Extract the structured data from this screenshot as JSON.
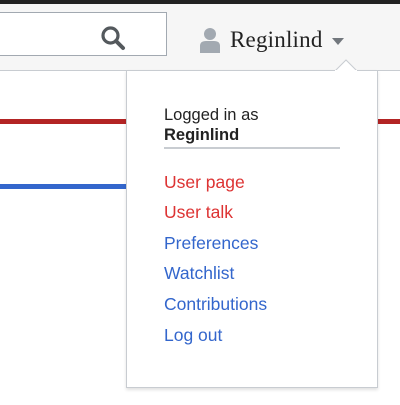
{
  "header": {
    "search": {
      "value": "",
      "icon": "search-icon"
    },
    "user": {
      "name": "Reginlind",
      "icon": "user-icon",
      "caret_icon": "chevron-down-icon"
    }
  },
  "dropdown": {
    "logged_in_label": "Logged in as",
    "username": "Reginlind",
    "items": [
      {
        "label": "User page",
        "color": "#dd3333"
      },
      {
        "label": "User talk",
        "color": "#dd3333"
      },
      {
        "label": "Preferences",
        "color": "#3366cc"
      },
      {
        "label": "Watchlist",
        "color": "#3366cc"
      },
      {
        "label": "Contributions",
        "color": "#3366cc"
      },
      {
        "label": "Log out",
        "color": "#3366cc"
      }
    ]
  },
  "colors": {
    "red_link": "#dd3333",
    "blue_link": "#3366cc",
    "bar_red": "#b32424",
    "bar_blue": "#3366cc"
  }
}
